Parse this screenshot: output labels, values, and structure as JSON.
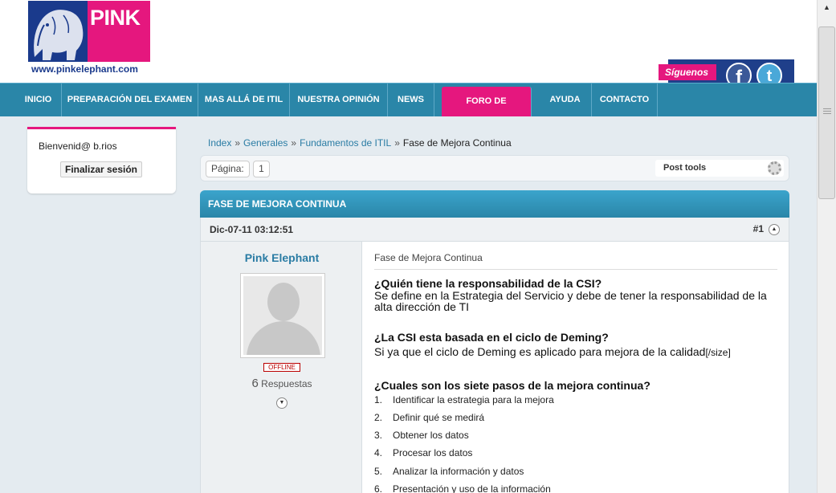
{
  "header": {
    "logo_text": "PINK",
    "logo_url": "www.pinkelephant.com",
    "follow_label": "Síguenos",
    "facebook_icon": "f",
    "twitter_icon": "t"
  },
  "nav": {
    "items": [
      {
        "label": "INICIO"
      },
      {
        "label": "PREPARACIÓN DEL EXAMEN"
      },
      {
        "label": "MAS ALLÁ DE ITIL"
      },
      {
        "label": "NUESTRA OPINIÓN"
      },
      {
        "label": "NEWS"
      },
      {
        "label": "FORO DE DISCUSIÓN",
        "active": true
      },
      {
        "label": "AYUDA"
      },
      {
        "label": "CONTACTO"
      }
    ],
    "accent": "#e5177e",
    "bar_color": "#2a86a8"
  },
  "sidebar": {
    "welcome": "Bienvenid@ b.rios",
    "logout_label": "Finalizar sesión"
  },
  "breadcrumb": {
    "items": [
      "Index",
      "Generales",
      "Fundamentos de ITIL"
    ],
    "current": "Fase de Mejora Continua",
    "separator": "»"
  },
  "toolbar": {
    "page_label": "Página:",
    "page_number": "1",
    "post_tools": "Post tools"
  },
  "thread": {
    "title": "FASE DE MEJORA CONTINUA"
  },
  "post": {
    "date": "Dic-07-11 03:12:51",
    "number": "#1",
    "author": "Pink Elephant",
    "status": "OFFLINE",
    "reply_count": "6",
    "reply_label": "Respuestas",
    "title": "Fase de Mejora Continua",
    "q1": "¿Quién tiene la responsabilidad de la CSI?",
    "a1": "Se define en la Estrategia del Servicio y debe de tener la responsabilidad de la alta dirección de TI",
    "q2": "¿La CSI esta basada en el ciclo de Deming?",
    "a2": "Si ya que el ciclo de Deming es aplicado para mejora de la calidad",
    "a2_tag": "[/size]",
    "q3": "¿Cuales son los siete pasos de la mejora continua?",
    "steps": [
      {
        "n": "1.",
        "text": "Identificar la estrategia para la mejora"
      },
      {
        "n": "2.",
        "text": "Definir qué se medirá"
      },
      {
        "n": "3.",
        "text": "Obtener los datos"
      },
      {
        "n": "4.",
        "text": "Procesar los datos"
      },
      {
        "n": "5.",
        "text": "Analizar la información y datos"
      },
      {
        "n": "6.",
        "text": "Presentación y uso de la información"
      }
    ]
  }
}
